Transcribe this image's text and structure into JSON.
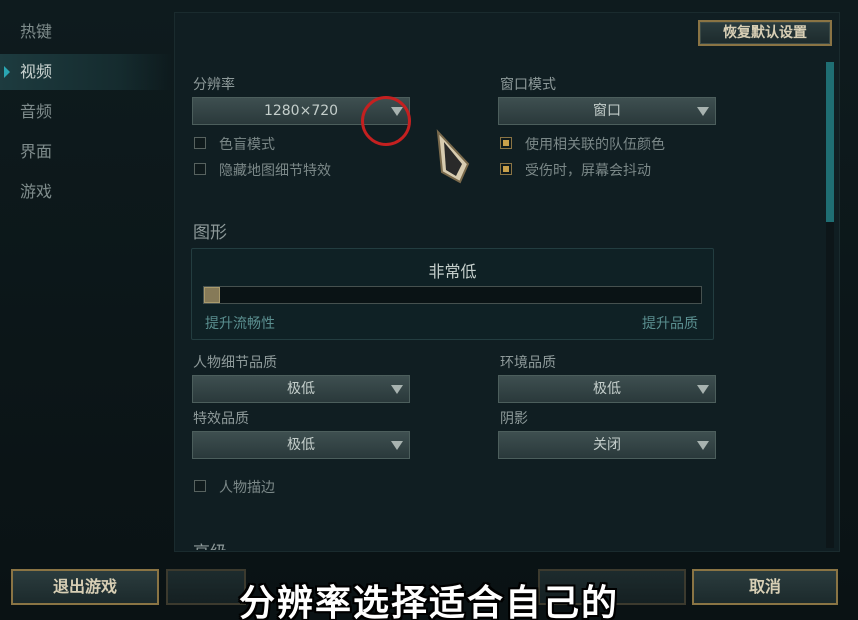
{
  "sidebar": {
    "items": [
      {
        "label": "热键"
      },
      {
        "label": "视频"
      },
      {
        "label": "音频"
      },
      {
        "label": "界面"
      },
      {
        "label": "游戏"
      }
    ],
    "active_index": 1
  },
  "header": {
    "restore_defaults_label": "恢复默认设置"
  },
  "display": {
    "resolution_label": "分辨率",
    "resolution_value": "1280×720",
    "window_mode_label": "窗口模式",
    "window_mode_value": "窗口",
    "checkboxes_left": [
      {
        "label": "色盲模式",
        "checked": false
      },
      {
        "label": "隐藏地图细节特效",
        "checked": false
      }
    ],
    "checkboxes_right": [
      {
        "label": "使用相关联的队伍颜色",
        "checked": true
      },
      {
        "label": "受伤时，屏幕会抖动",
        "checked": true
      }
    ]
  },
  "graphics": {
    "section_title": "图形",
    "preset_value": "非常低",
    "slider_level": 0,
    "slider_left_hint": "提升流畅性",
    "slider_right_hint": "提升品质",
    "character_quality_label": "人物细节品质",
    "character_quality_value": "极低",
    "environment_quality_label": "环境品质",
    "environment_quality_value": "极低",
    "effects_quality_label": "特效品质",
    "effects_quality_value": "极低",
    "shadows_label": "阴影",
    "shadows_value": "关闭",
    "outline_label": "人物描边",
    "outline_checked": false
  },
  "advanced": {
    "section_title": "高级"
  },
  "footer": {
    "exit_game_label": "退出游戏",
    "cancel_label": "取消"
  },
  "overlay": {
    "subtitle": "分辨率选择适合自己的"
  },
  "colors": {
    "accent_gold": "#8a7444",
    "accent_teal": "#2aa7b4",
    "annotation_red": "#c42020"
  }
}
